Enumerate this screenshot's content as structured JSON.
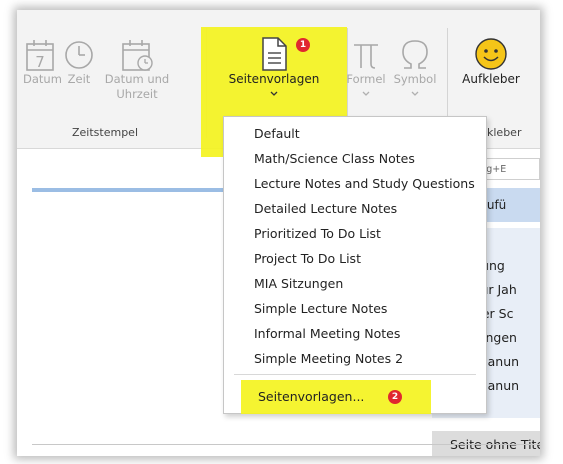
{
  "ribbon": {
    "datum": "Datum",
    "zeit": "Zeit",
    "datum_uhrzeit_line1": "Datum und",
    "datum_uhrzeit_line2": "Uhrzeit",
    "zeitstempel_group": "Zeitstempel",
    "seitenvorlagen": "Seitenvorlagen",
    "formel": "Formel",
    "symbol": "Symbol",
    "aufkleber": "Aufkleber",
    "aufkleber_group_partial": "kleber",
    "calendar_day": "7"
  },
  "badges": {
    "seitenvorlagen_button": "1",
    "seitenvorlagen_menu_item": "2"
  },
  "search": {
    "partial_text": "n (Strg+E"
  },
  "right_panel": {
    "header": "hinzufü",
    "items": [
      "lanung",
      "n zur Jah",
      "n der Sc",
      "anungen",
      "esplanun",
      "esplanun"
    ],
    "selected_page": "Seite ohne Titel"
  },
  "dropdown": {
    "items": [
      "Default",
      "Math/Science Class Notes",
      "Lecture Notes and Study Questions",
      "Detailed Lecture Notes",
      "Prioritized To Do List",
      "Project To Do List",
      "MIA Sitzungen",
      "Simple Lecture Notes",
      "Informal Meeting Notes",
      "Simple Meeting Notes 2"
    ],
    "more_label": "Seitenvorlagen..."
  },
  "colors": {
    "highlight_yellow": "#f4f31f",
    "badge_red": "#e0282f",
    "blue_strip": "#9bbde4",
    "panel_header_blue": "#c9daf0",
    "sticker_yellow": "#f5c518"
  },
  "icons": [
    "calendar-icon",
    "clock-icon",
    "calendar-clock-icon",
    "page-template-icon",
    "pi-icon",
    "omega-icon",
    "smiley-sticker-icon",
    "chevron-down-icon"
  ]
}
